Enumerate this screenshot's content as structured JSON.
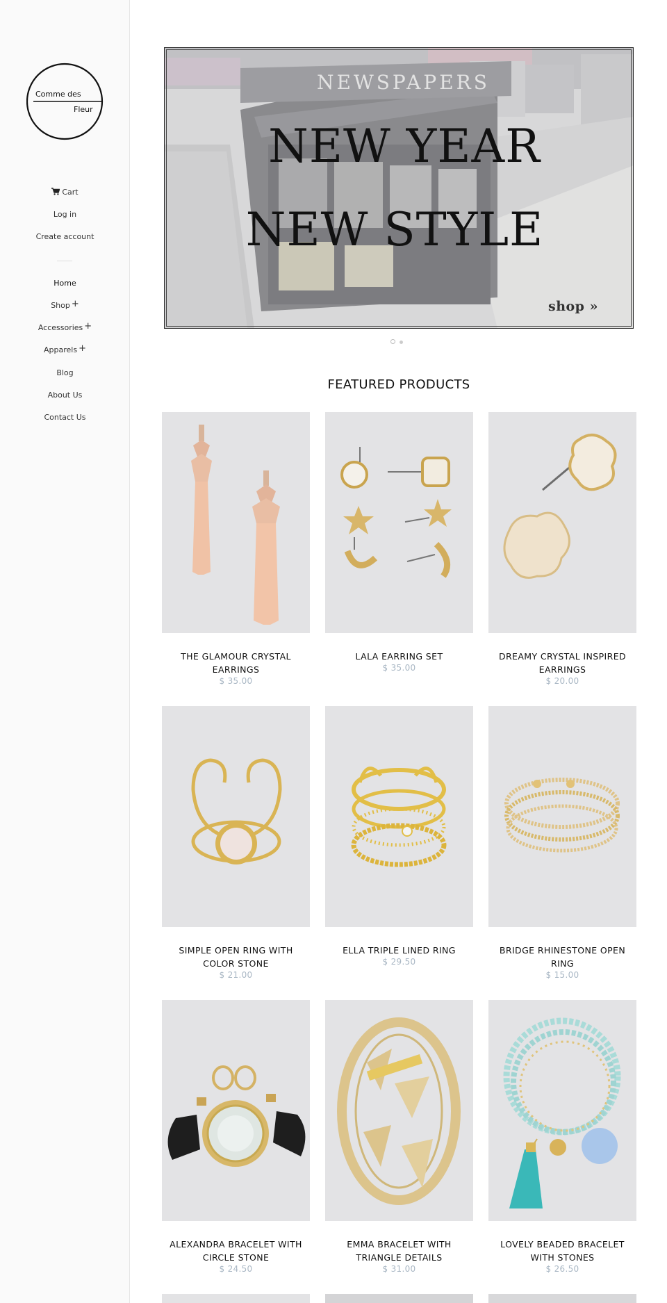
{
  "store": {
    "logo_line1": "Comme des",
    "logo_line2": "Fleur"
  },
  "account": {
    "cart_label": "Cart",
    "login_label": "Log in",
    "create_label": "Create account"
  },
  "nav": {
    "home": "Home",
    "shop": "Shop",
    "accessories": "Accessories",
    "apparels": "Apparels",
    "blog": "Blog",
    "about": "About Us",
    "contact": "Contact Us",
    "plus": "+"
  },
  "hero": {
    "sign_text": "NEWSPAPERS",
    "title_line1": "NEW YEAR",
    "title_line2": "NEW STYLE",
    "cta": "shop »"
  },
  "featured": {
    "title": "FEATURED PRODUCTS",
    "products": [
      {
        "name": "THE GLAMOUR CRYSTAL EARRINGS",
        "price": "$ 35.00",
        "icon": "earrings-long-crystal"
      },
      {
        "name": "LALA EARRING SET",
        "price": "$ 35.00",
        "icon": "earring-set"
      },
      {
        "name": "DREAMY CRYSTAL INSPIRED EARRINGS",
        "price": "$ 20.00",
        "icon": "flower-earrings"
      },
      {
        "name": "SIMPLE OPEN RING WITH COLOR STONE",
        "price": "$ 21.00",
        "icon": "open-ring"
      },
      {
        "name": "ELLA TRIPLE LINED RING",
        "price": "$ 29.50",
        "icon": "triple-ring"
      },
      {
        "name": "BRIDGE RHINESTONE OPEN RING",
        "price": "$ 15.00",
        "icon": "rhinestone-ring"
      },
      {
        "name": "ALEXANDRA BRACELET WITH CIRCLE STONE",
        "price": "$ 24.50",
        "icon": "circle-stone-bracelet"
      },
      {
        "name": "EMMA BRACELET WITH TRIANGLE DETAILS",
        "price": "$ 31.00",
        "icon": "triangle-bracelet"
      },
      {
        "name": "LOVELY BEADED BRACELET WITH STONES",
        "price": "$ 26.50",
        "icon": "beaded-bracelet"
      }
    ]
  }
}
